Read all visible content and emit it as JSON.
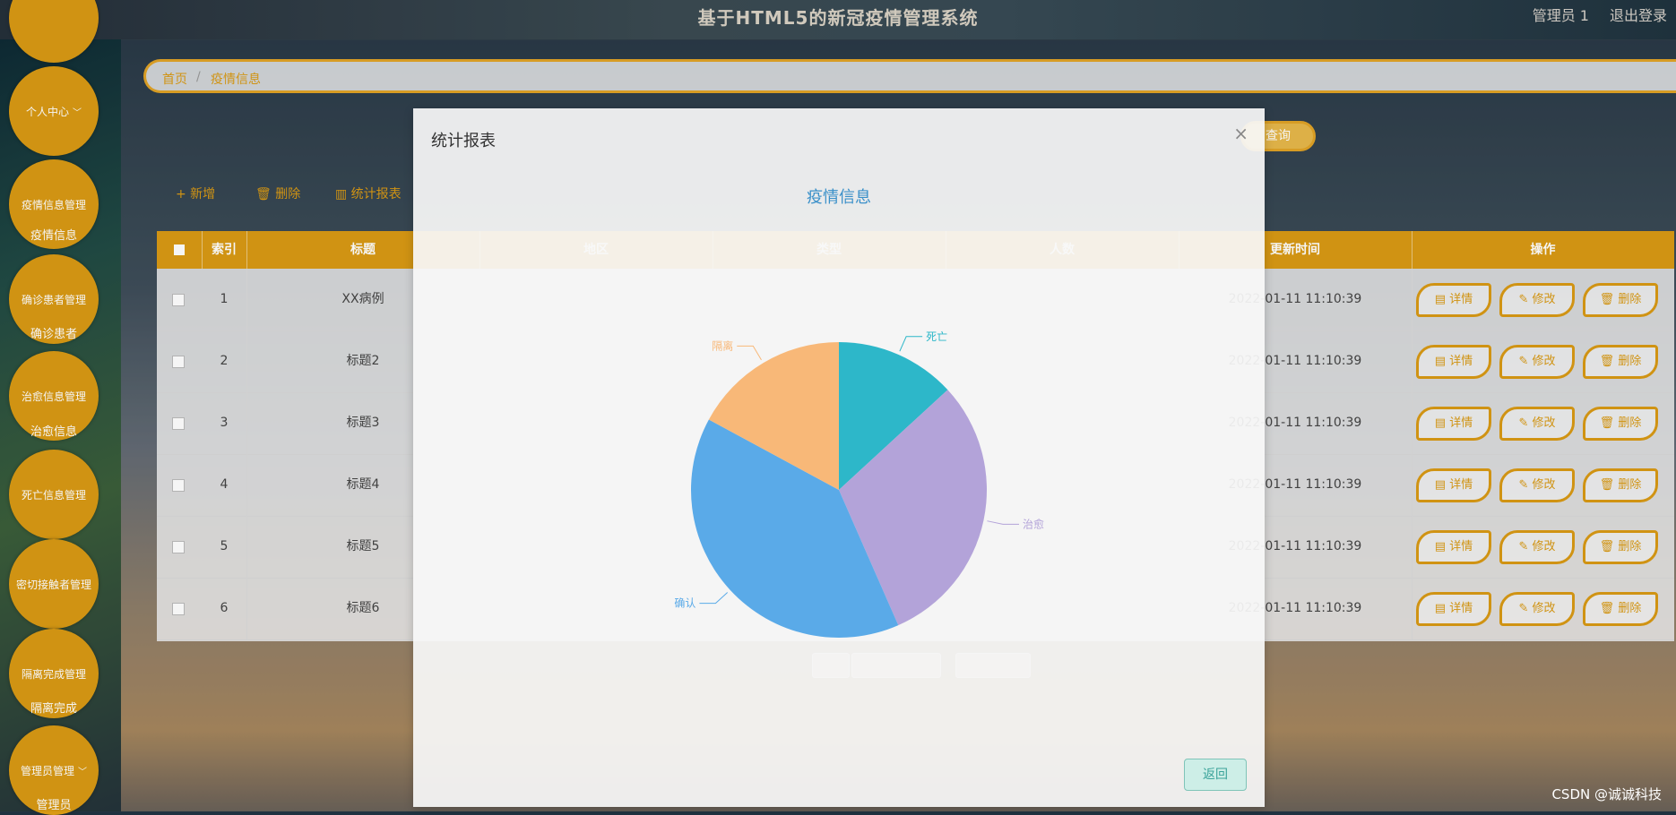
{
  "header": {
    "title": "基于HTML5的新冠疫情管理系统",
    "user": "管理员 1",
    "logout": "退出登录"
  },
  "sidebar": [
    {
      "label": "个人中心",
      "sub": "",
      "chevron": true
    },
    {
      "label": "疫情信息管理",
      "sub": "疫情信息"
    },
    {
      "label": "确诊患者管理",
      "sub": "确诊患者"
    },
    {
      "label": "治愈信息管理",
      "sub": "治愈信息"
    },
    {
      "label": "死亡信息管理",
      "sub": ""
    },
    {
      "label": "密切接触者管理",
      "sub": ""
    },
    {
      "label": "隔离完成管理",
      "sub": "隔离完成"
    },
    {
      "label": "管理员管理",
      "sub": "管理员",
      "chevron": true
    }
  ],
  "breadcrumb": {
    "home": "首页",
    "sep": "/",
    "current": "疫情信息"
  },
  "search": {
    "button": "查询"
  },
  "actions": {
    "add": "+ 新增",
    "delete": "🗑 删除",
    "stats": "▥ 统计报表"
  },
  "table": {
    "headers": [
      "索引",
      "标题",
      "地区",
      "类型",
      "人数",
      "更新时间",
      "操作"
    ],
    "rows": [
      {
        "index": "1",
        "title": "XX病例",
        "time": "2022-01-11 11:10:39"
      },
      {
        "index": "2",
        "title": "标题2",
        "time": "2022-01-11 11:10:39"
      },
      {
        "index": "3",
        "title": "标题3",
        "time": "2022-01-11 11:10:39"
      },
      {
        "index": "4",
        "title": "标题4",
        "time": "2022-01-11 11:10:39"
      },
      {
        "index": "5",
        "title": "标题5",
        "time": "2022-01-11 11:10:39"
      },
      {
        "index": "6",
        "title": "标题6",
        "time": "2022-01-11 11:10:39"
      }
    ],
    "op_labels": {
      "detail": "详情",
      "edit": "修改",
      "delete": "删除"
    }
  },
  "modal": {
    "title": "统计报表",
    "close": "×",
    "chart_title": "疫情信息",
    "back": "返回"
  },
  "chart_data": {
    "type": "pie",
    "title": "疫情信息",
    "slices": [
      {
        "label": "死亡",
        "value": 1,
        "color": "#2db7c9"
      },
      {
        "label": "治愈",
        "value": 2.3,
        "color": "#b3a3d9"
      },
      {
        "label": "确认",
        "value": 3,
        "color": "#5aaae8"
      },
      {
        "label": "隔离",
        "value": 1.3,
        "color": "#f8b878"
      }
    ]
  },
  "watermark": "CSDN @诚诚科技"
}
